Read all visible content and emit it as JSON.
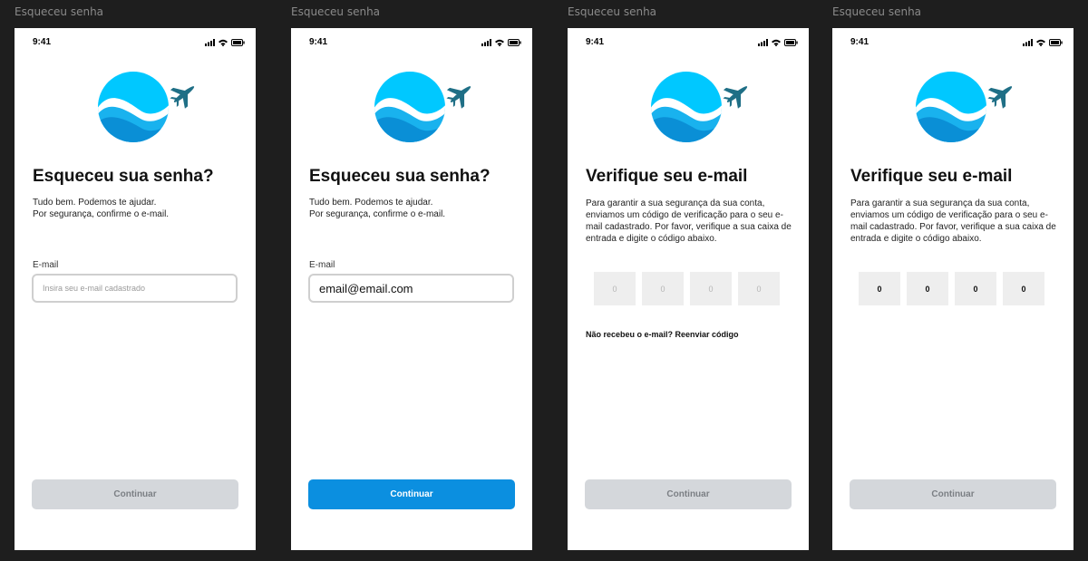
{
  "frames": [
    {
      "label": "Esqueceu senha",
      "time": "9:41",
      "title": "Esqueceu sua senha?",
      "subtitle": "Tudo bem. Podemos te ajudar.\nPor segurança, confirme o e-mail.",
      "field_label": "E-mail",
      "input_placeholder": "Insira seu e-mail cadastrado",
      "button": "Continuar"
    },
    {
      "label": "Esqueceu senha",
      "time": "9:41",
      "title": "Esqueceu sua senha?",
      "subtitle": "Tudo bem. Podemos te ajudar.\nPor segurança, confirme o e-mail.",
      "field_label": "E-mail",
      "input_value": "email@email.com",
      "button": "Continuar"
    },
    {
      "label": "Esqueceu senha",
      "time": "9:41",
      "title": "Verifique seu e-mail",
      "subtitle": "Para garantir a sua segurança da sua conta, enviamos um código de verificação para o seu e-mail cadastrado. Por favor, verifique a sua caixa de entrada e digite o código abaixo.",
      "code": [
        "0",
        "0",
        "0",
        "0"
      ],
      "resend": "Não recebeu o e-mail? Reenviar código",
      "button": "Continuar"
    },
    {
      "label": "Esqueceu senha",
      "time": "9:41",
      "title": "Verifique seu e-mail",
      "subtitle": "Para garantir a sua segurança da sua conta, enviamos um código de verificação para o seu e-mail cadastrado. Por favor, verifique a sua caixa de entrada e digite o código abaixo.",
      "code": [
        "0",
        "0",
        "0",
        "0"
      ],
      "button": "Continuar"
    }
  ],
  "colors": {
    "canvas": "#1e1e1e",
    "primary": "#0b8fe0",
    "button_disabled": "#d4d7db",
    "logo_light": "#00c8ff",
    "logo_dark": "#0a8fd6",
    "plane": "#1f6f86"
  }
}
